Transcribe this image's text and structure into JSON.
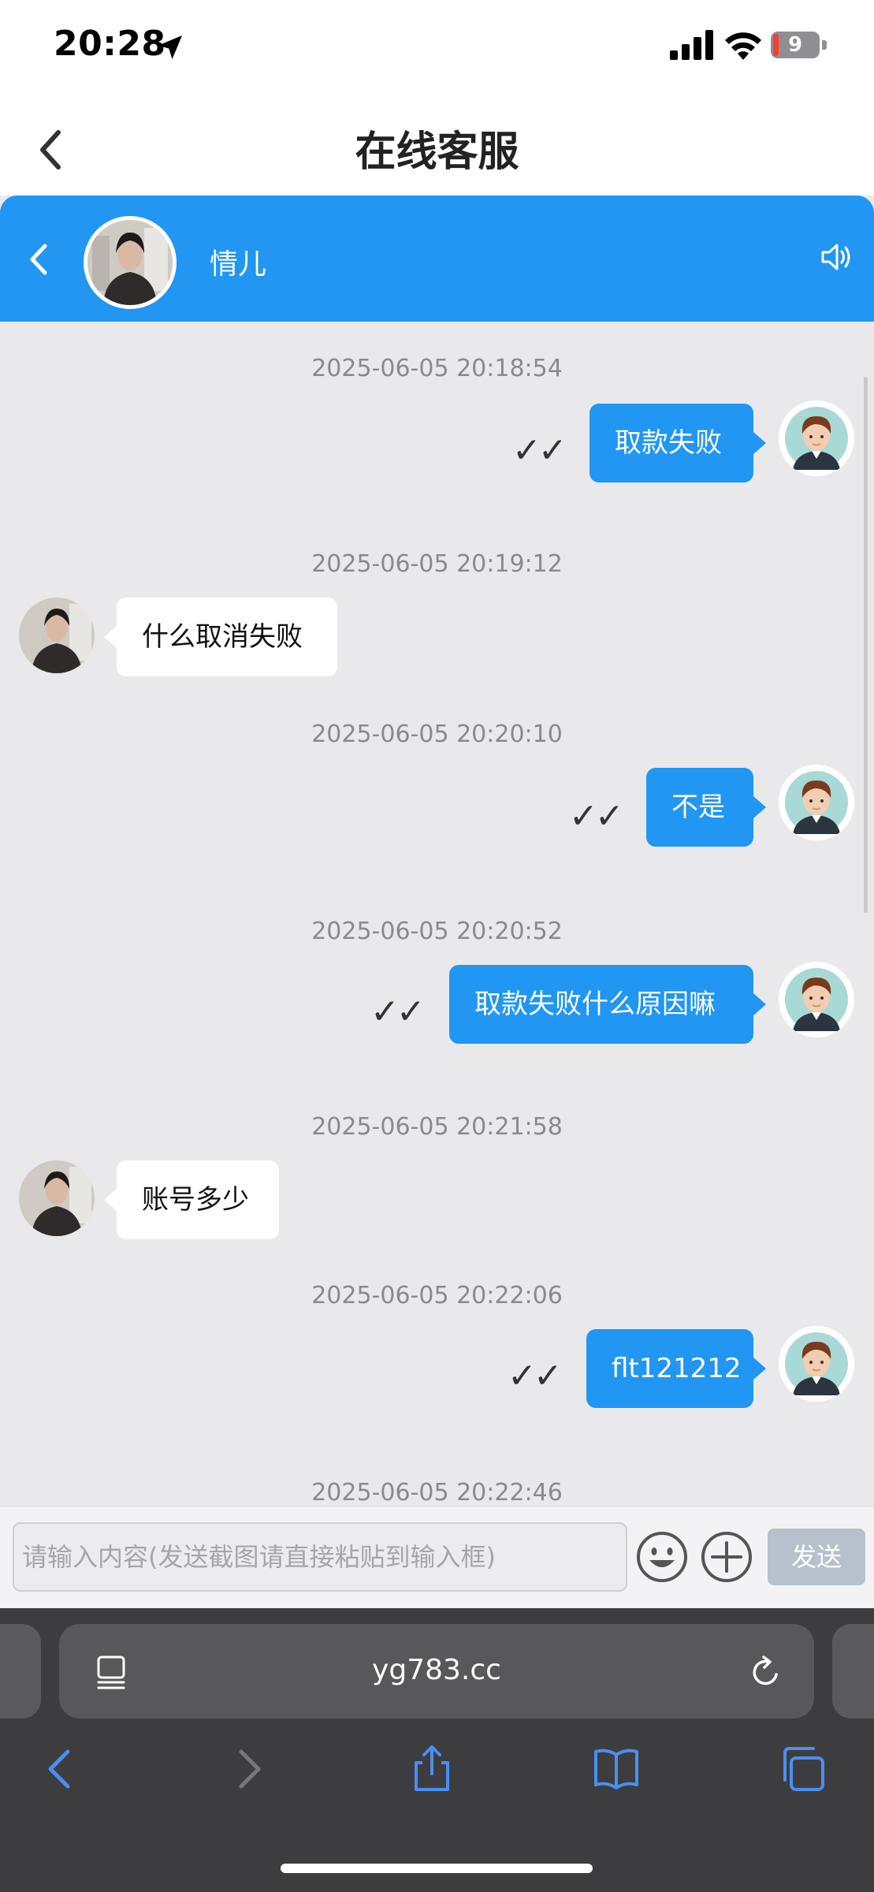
{
  "status_bar": {
    "time": "20:28",
    "battery": "9"
  },
  "nav": {
    "title": "在线客服"
  },
  "chat_header": {
    "agent_name": "情儿"
  },
  "messages": [
    {
      "time": "2025-06-05 20:18:54",
      "direction": "out",
      "text": "取款失败",
      "read": "✓✓"
    },
    {
      "time": "2025-06-05 20:19:12",
      "direction": "in",
      "text": "什么取消失败"
    },
    {
      "time": "2025-06-05 20:20:10",
      "direction": "out",
      "text": "不是",
      "read": "✓✓"
    },
    {
      "time": "2025-06-05 20:20:52",
      "direction": "out",
      "text": "取款失败什么原因嘛",
      "read": "✓✓"
    },
    {
      "time": "2025-06-05 20:21:58",
      "direction": "in",
      "text": "账号多少"
    },
    {
      "time": "2025-06-05 20:22:06",
      "direction": "out",
      "text": "flt121212",
      "read": "✓✓"
    },
    {
      "time": "2025-06-05 20:22:46"
    }
  ],
  "input": {
    "placeholder": "请输入内容(发送截图请直接粘贴到输入框)",
    "value": "",
    "send_label": "发送"
  },
  "browser": {
    "url": "yg783.cc"
  },
  "colors": {
    "accent": "#2196f3",
    "bubble_in": "#ffffff",
    "send_disabled": "#b6c1cd"
  },
  "icons": {
    "status": [
      "location-arrow-icon",
      "cellular-signal-icon",
      "wifi-icon",
      "battery-icon"
    ],
    "chat": [
      "back-chevron-icon",
      "speaker-icon",
      "emoji-icon",
      "plus-circle-icon"
    ],
    "browser": [
      "page-menu-icon",
      "reload-icon",
      "back-icon",
      "forward-icon",
      "share-icon",
      "bookmarks-icon",
      "tabs-icon"
    ]
  }
}
